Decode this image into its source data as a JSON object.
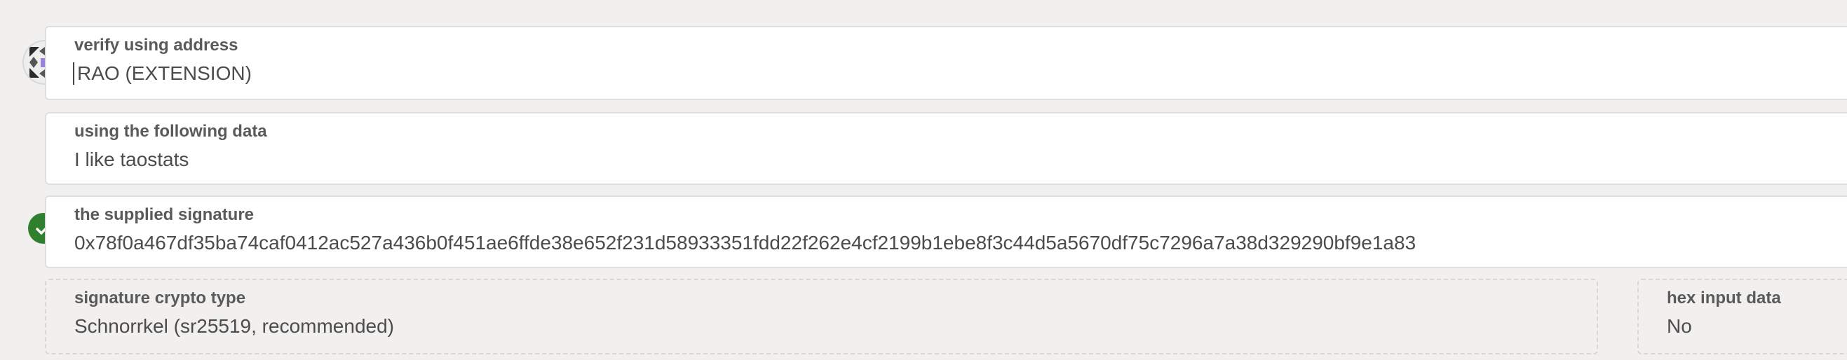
{
  "verify_section": {
    "address_label": "verify using address",
    "address_value": "RAO (EXTENSION)",
    "data_label": "using the following data",
    "data_value": "I like taostats",
    "signature_label": "the supplied signature",
    "signature_value": "0x78f0a467df35ba74caf0412ac527a436b0f451ae6ffde38e652f231d58933351fdd22f262e4cf2199b1ebe8f3c44d5a5670df75c7296a7a38d329290bf9e1a83",
    "signature_valid_icon": "check-circle-icon",
    "crypto_type_label": "signature crypto type",
    "crypto_type_value": "Schnorrkel (sr25519, recommended)",
    "hex_input_label": "hex input data",
    "hex_input_value": "No"
  },
  "colors": {
    "background": "#f1f0ef",
    "valid_badge": "#2f7f2f",
    "identicon_accent": "#9a82dc"
  }
}
